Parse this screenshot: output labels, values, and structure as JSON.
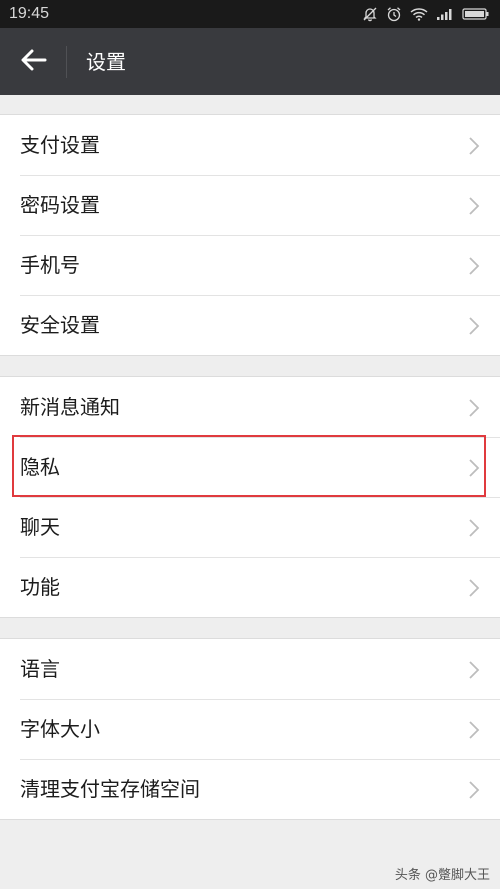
{
  "status_bar": {
    "time": "19:45",
    "icons": [
      "mute-bell-icon",
      "alarm-icon",
      "wifi-icon",
      "signal-icon",
      "battery-icon"
    ]
  },
  "app_bar": {
    "back_icon": "arrow-left-icon",
    "title": "设置"
  },
  "groups": [
    {
      "items": [
        {
          "label": "支付设置"
        },
        {
          "label": "密码设置"
        },
        {
          "label": "手机号"
        },
        {
          "label": "安全设置"
        }
      ]
    },
    {
      "items": [
        {
          "label": "新消息通知"
        },
        {
          "label": "隐私"
        },
        {
          "label": "聊天"
        },
        {
          "label": "功能"
        }
      ]
    },
    {
      "items": [
        {
          "label": "语言"
        },
        {
          "label": "字体大小"
        },
        {
          "label": "清理支付宝存储空间"
        }
      ]
    }
  ],
  "annotation": {
    "highlight_color": "#e03a3e",
    "highlighted_item": "隐私"
  },
  "watermark": "头条 @蹩脚大王",
  "colors": {
    "status_bar": "#1a1a1a",
    "app_bar": "#393a3e",
    "background": "#eeeeee",
    "row_background": "#ffffff"
  }
}
